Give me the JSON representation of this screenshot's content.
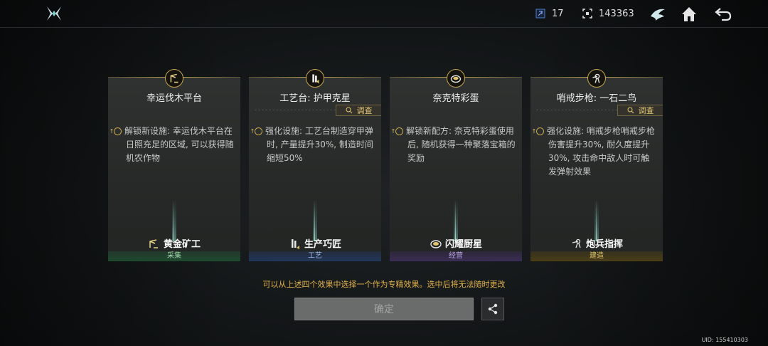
{
  "topbar": {
    "resource_1": {
      "icon": "crystal-icon",
      "value": "17"
    },
    "resource_2": {
      "icon": "scan-frame-icon",
      "value": "143363"
    }
  },
  "cards": [
    {
      "title": "幸运伐木平台",
      "has_inspect": false,
      "description": "解锁新设施: 幸运伐木平台在日照充足的区域, 可以获得随机农作物",
      "profession": "黄金矿工",
      "category": "采集",
      "category_color": "green",
      "icon": "lumber-crane-icon"
    },
    {
      "title": "工艺台: 护甲克星",
      "has_inspect": true,
      "description": "强化设施: 工艺台制造穿甲弹时, 产量提升30%, 制造时间缩短50%",
      "profession": "生产巧匠",
      "category": "工艺",
      "category_color": "blue",
      "icon": "ammo-icon"
    },
    {
      "title": "奈克特彩蛋",
      "has_inspect": false,
      "description": "解锁新配方: 奈克特彩蛋使用后, 随机获得一种聚落宝箱的奖励",
      "profession": "闪耀厨星",
      "category": "经营",
      "category_color": "purple",
      "icon": "dish-icon"
    },
    {
      "title": "哨戒步枪: 一石二鸟",
      "has_inspect": true,
      "description": "强化设施: 哨戒步枪哨戒步枪伤害提升30%, 耐久度提升30%, 攻击命中敌人时可触发弹射效果",
      "profession": "炮兵指挥",
      "category": "建造",
      "category_color": "gold",
      "icon": "turret-icon"
    }
  ],
  "inspect_label": "调查",
  "hint": "可以从上述四个效果中选择一个作为专精效果。选中后将无法随时更改",
  "confirm_label": "确定",
  "uid": "UID: 155410303",
  "colors": {
    "accent_gold": "#c8a651",
    "hint": "#e0b14c"
  }
}
